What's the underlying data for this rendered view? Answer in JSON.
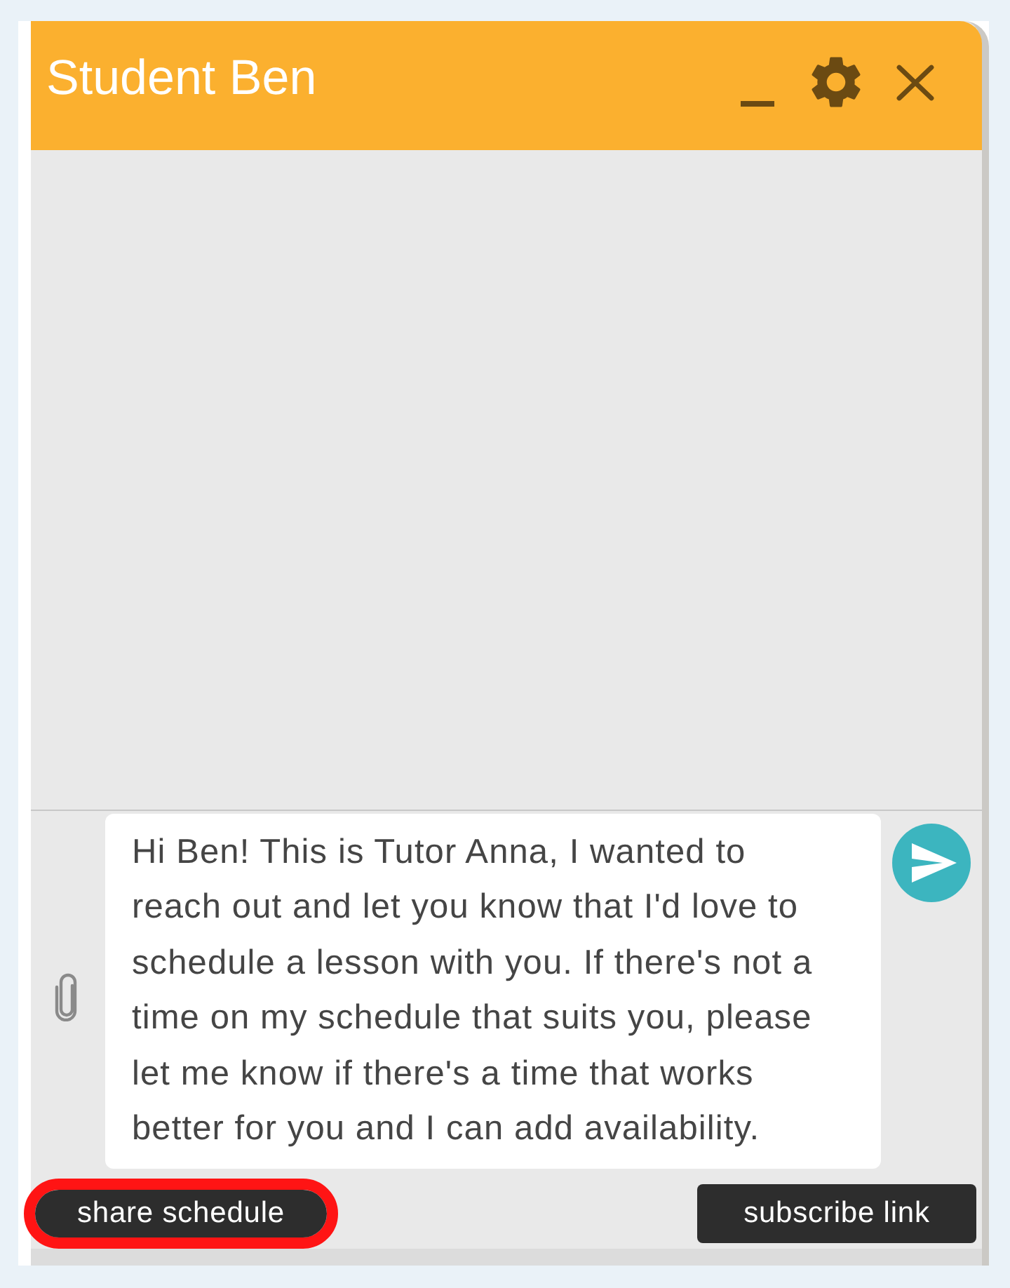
{
  "window": {
    "title": "Student Ben"
  },
  "composer": {
    "value": "Hi Ben! This is Tutor Anna, I wanted to reach out and let you know that I'd love to schedule a lesson with you. If there's not a time on my schedule that suits you, please let me know if there's a time that works better for you and I can add availability."
  },
  "actions": [
    {
      "label": "share schedule",
      "highlighted": true
    },
    {
      "label": "subscribe link",
      "highlighted": false
    }
  ]
}
